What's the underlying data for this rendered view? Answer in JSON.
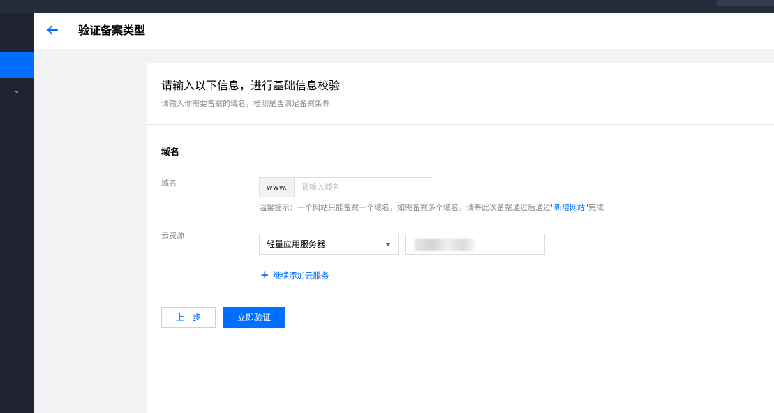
{
  "header": {
    "back_icon": "arrow-left-icon",
    "title": "验证备案类型"
  },
  "intro": {
    "title": "请输入以下信息，进行基础信息校验",
    "subtitle": "请输入你需要备案的域名，检测是否满足备案条件"
  },
  "form": {
    "section_title": "域名",
    "domain": {
      "label": "域名",
      "prefix": "www.",
      "placeholder": "请输入域名",
      "value": "",
      "hint_text": "温馨提示：一个网站只能备案一个域名，如需备案多个域名，请等此次备案通过后通过",
      "hint_link": "\"新增网站\"",
      "hint_suffix": "完成"
    },
    "cloud_resource": {
      "label": "云资源",
      "selected": "轻量应用服务器"
    },
    "add_more": {
      "icon": "plus-icon",
      "label": "继续添加云服务"
    }
  },
  "actions": {
    "prev_label": "上一步",
    "verify_label": "立即验证"
  },
  "colors": {
    "accent": "#006eff",
    "sidebar": "#1f2430",
    "topbar": "#262d3a"
  }
}
